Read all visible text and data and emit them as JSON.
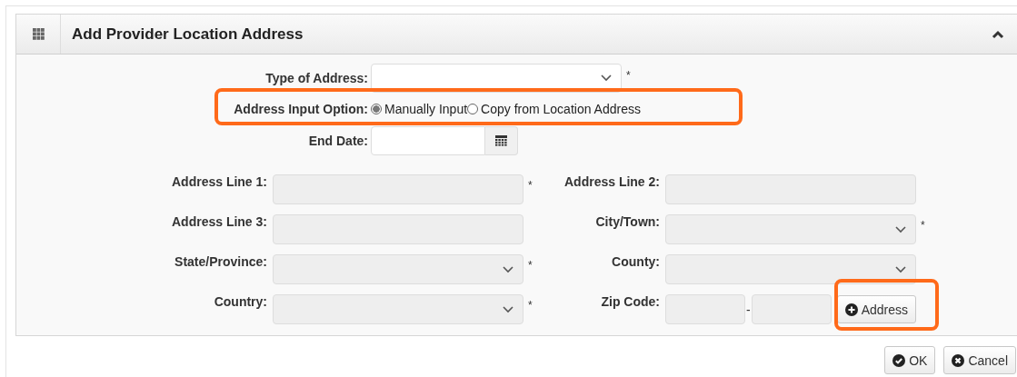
{
  "panel": {
    "title": "Add Provider Location Address",
    "expanded": true
  },
  "top_fields": [
    {
      "label": "Type of Address:",
      "kind": "select",
      "required": true,
      "disabled": false
    },
    {
      "label": "Address Input Option:",
      "kind": "radio",
      "highlighted": true,
      "options": [
        {
          "label": "Manually Input",
          "selected": true
        },
        {
          "label": "Copy from Location Address",
          "selected": false
        }
      ]
    },
    {
      "label": "End Date:",
      "kind": "date",
      "required": false,
      "disabled": false
    }
  ],
  "address_fields": [
    {
      "label": "Address Line 1:",
      "kind": "text",
      "required": true,
      "disabled": true
    },
    {
      "label": "Address Line 2:",
      "kind": "text",
      "required": false,
      "disabled": true
    },
    {
      "label": "Address Line 3:",
      "kind": "text",
      "required": false,
      "disabled": true
    },
    {
      "label": "City/Town:",
      "kind": "select",
      "required": true,
      "disabled": true
    },
    {
      "label": "State/Province:",
      "kind": "select",
      "required": true,
      "disabled": true
    },
    {
      "label": "County:",
      "kind": "select",
      "required": false,
      "disabled": true
    },
    {
      "label": "Country:",
      "kind": "select",
      "required": true,
      "disabled": true
    },
    {
      "label": "Zip Code:",
      "kind": "zip",
      "separator": "-",
      "button": "Address",
      "button_highlighted": true,
      "required": false,
      "disabled": true
    }
  ],
  "required_mark": "*",
  "buttons": [
    {
      "label": "OK",
      "kind": "ok"
    },
    {
      "label": "Cancel",
      "kind": "cancel"
    }
  ]
}
